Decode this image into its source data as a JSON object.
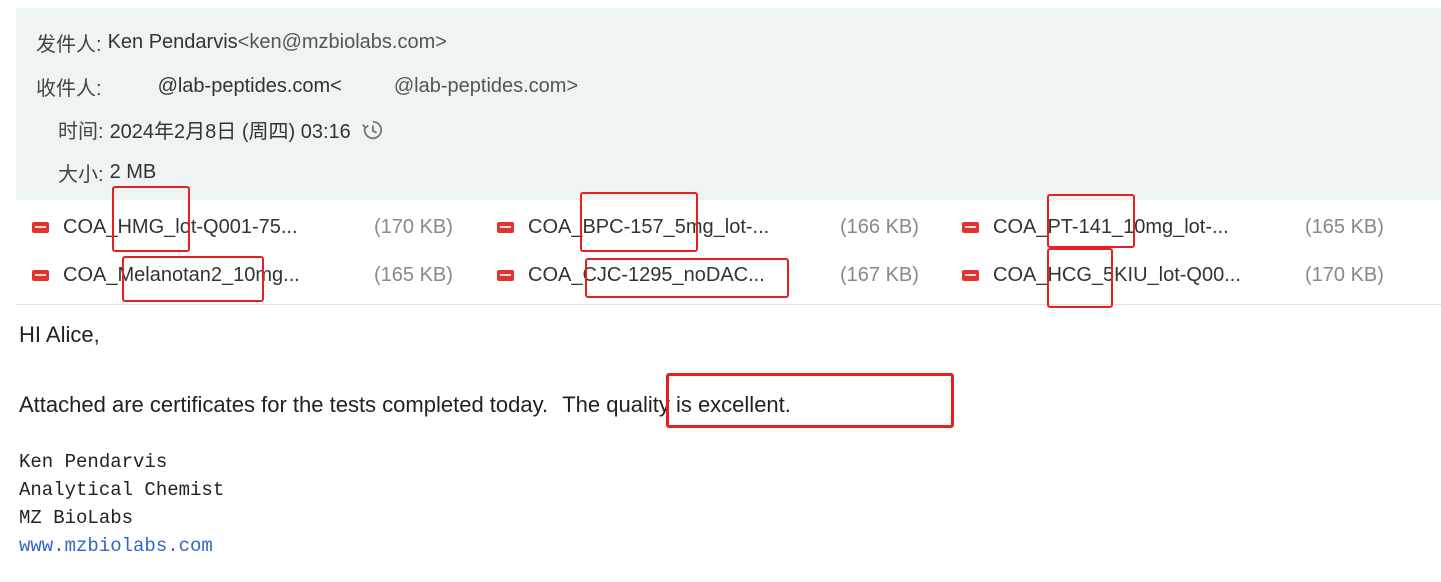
{
  "header": {
    "from_label": "发件人:",
    "from_name": "Ken Pendarvis",
    "from_email": "<ken@mzbiolabs.com>",
    "to_label": "收件人:",
    "to_name": "@lab-peptides.com<",
    "to_email": "@lab-peptides.com>",
    "time_label": "时间:",
    "time_value": "2024年2月8日 (周四) 03:16",
    "size_label": "大小:",
    "size_value": "2 MB"
  },
  "attachments": [
    {
      "prefix": "COA_",
      "highlight": "HMG",
      "suffix": "_lot-Q001-75...",
      "size": "(170 KB)"
    },
    {
      "prefix": "COA_",
      "highlight": "BPC-157",
      "suffix": "_5mg_lot-...",
      "size": "(166 KB)"
    },
    {
      "prefix": "COA_",
      "highlight": "PT-141",
      "suffix": "_10mg_lot-...",
      "size": "(165 KB)"
    },
    {
      "prefix": "COA_",
      "highlight": "Melanotan2",
      "suffix": "_10mg...",
      "size": "(165 KB)"
    },
    {
      "prefix": "COA_",
      "highlight": "CJC-1295_noDAC",
      "suffix": "...",
      "size": "(167 KB)"
    },
    {
      "prefix": "COA_",
      "highlight": "HCG",
      "suffix": "_5KIU_lot-Q00...",
      "size": "(170 KB)"
    }
  ],
  "body": {
    "greeting": "HI Alice,",
    "line1": "Attached are certificates for the tests completed today.",
    "line1_highlight": "The quality is excellent."
  },
  "signature": {
    "name": "Ken Pendarvis",
    "title": "Analytical Chemist",
    "company": "MZ BioLabs",
    "link": "www.mzbiolabs.com"
  },
  "colors": {
    "header_bg": "#eef3f3",
    "highlight_border": "#e52020",
    "pdf_icon": "#e5322d",
    "link": "#3366cc"
  }
}
